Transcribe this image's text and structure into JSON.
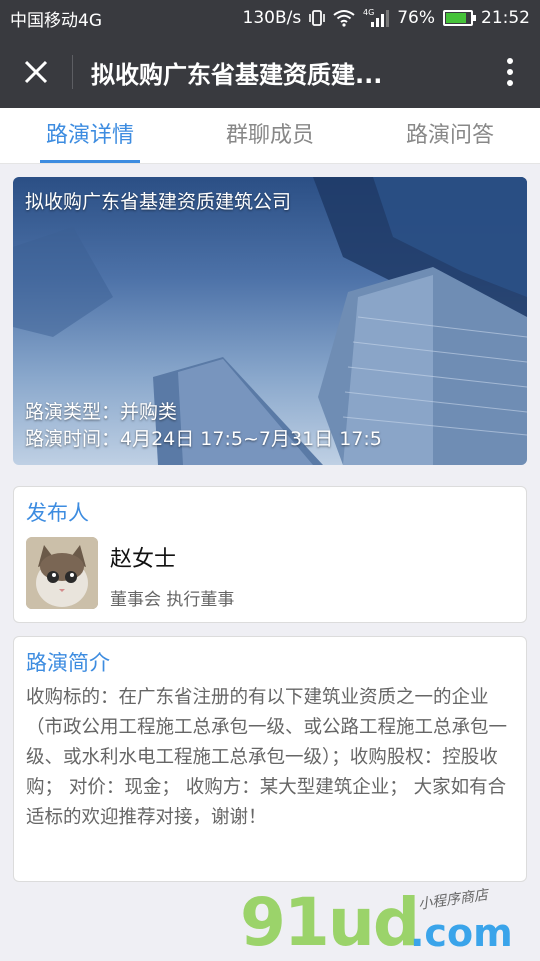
{
  "status_bar": {
    "carrier": "中国移动4G",
    "speed": "130B/s",
    "network": "4G",
    "battery": "76%",
    "time": "21:52"
  },
  "nav": {
    "title": "拟收购广东省基建资质建..."
  },
  "tabs": [
    {
      "label": "路演详情",
      "active": true
    },
    {
      "label": "群聊成员",
      "active": false
    },
    {
      "label": "路演问答",
      "active": false
    }
  ],
  "banner": {
    "title": "拟收购广东省基建资质建筑公司",
    "type_line": "路演类型：并购类",
    "time_line": "路演时间：4月24日 17:5~7月31日 17:5"
  },
  "publisher": {
    "heading": "发布人",
    "name": "赵女士",
    "role": "董事会 执行董事"
  },
  "intro": {
    "heading": "路演简介",
    "body": "收购标的：在广东省注册的有以下建筑业资质之一的企业（市政公用工程施工总承包一级、或公路工程施工总承包一级、或水利水电工程施工总承包一级）；收购股权：控股收购； 对价：现金； 收购方：某大型建筑企业； 大家如有合适标的欢迎推荐对接，谢谢！"
  },
  "watermark": {
    "big": "91ud",
    "com": ".com",
    "small": "小程序商店"
  },
  "colors": {
    "accent": "#3d8ce0",
    "topbar": "#393a3f",
    "background": "#efeff4"
  }
}
